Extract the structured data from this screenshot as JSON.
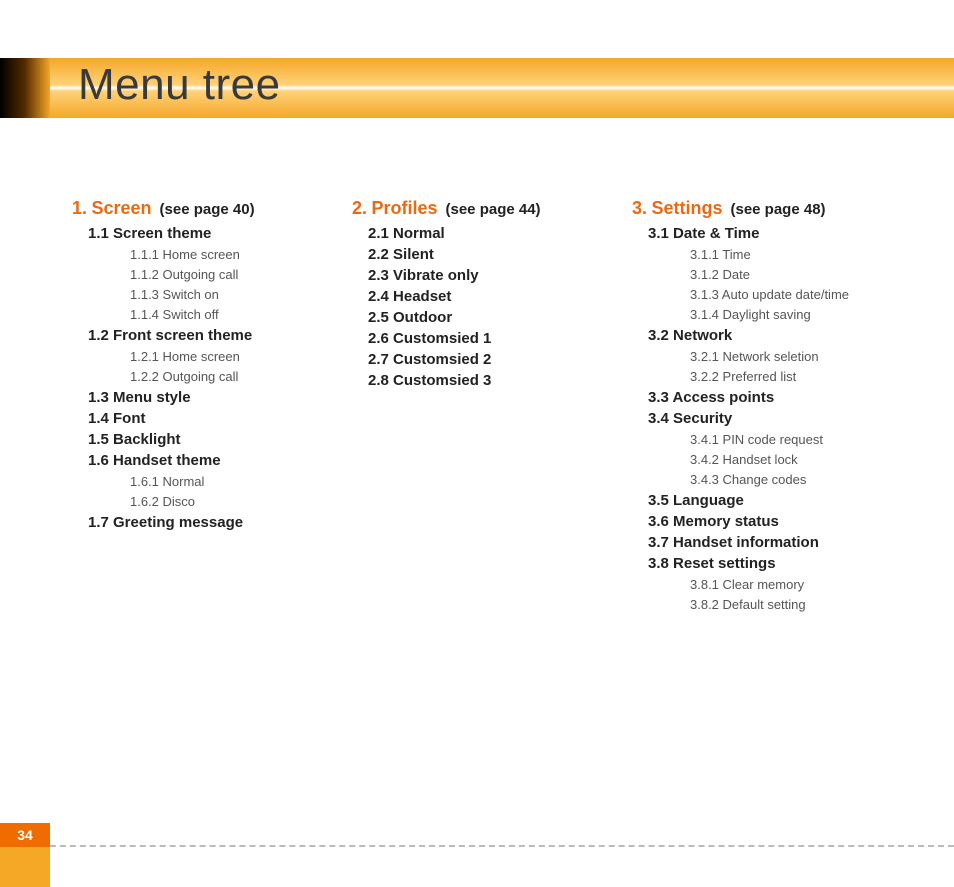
{
  "title": "Menu tree",
  "pageNumber": "34",
  "columns": [
    {
      "num": "1.",
      "name": "Screen",
      "ref": "(see page 40)",
      "items": [
        {
          "label": "1.1 Screen theme",
          "sub": [
            "1.1.1 Home screen",
            "1.1.2 Outgoing call",
            "1.1.3 Switch on",
            "1.1.4 Switch off"
          ]
        },
        {
          "label": "1.2 Front screen theme",
          "sub": [
            "1.2.1 Home screen",
            "1.2.2 Outgoing call"
          ]
        },
        {
          "label": "1.3 Menu style",
          "sub": []
        },
        {
          "label": "1.4 Font",
          "sub": []
        },
        {
          "label": "1.5 Backlight",
          "sub": []
        },
        {
          "label": "1.6 Handset theme",
          "sub": [
            "1.6.1 Normal",
            "1.6.2 Disco"
          ]
        },
        {
          "label": "1.7 Greeting message",
          "sub": []
        }
      ]
    },
    {
      "num": "2.",
      "name": "Profiles",
      "ref": "(see page 44)",
      "items": [
        {
          "label": "2.1 Normal",
          "sub": []
        },
        {
          "label": "2.2 Silent",
          "sub": []
        },
        {
          "label": "2.3 Vibrate only",
          "sub": []
        },
        {
          "label": "2.4 Headset",
          "sub": []
        },
        {
          "label": "2.5 Outdoor",
          "sub": []
        },
        {
          "label": "2.6 Customsied 1",
          "sub": []
        },
        {
          "label": "2.7 Customsied 2",
          "sub": []
        },
        {
          "label": "2.8 Customsied 3",
          "sub": []
        }
      ]
    },
    {
      "num": "3.",
      "name": "Settings",
      "ref": "(see page 48)",
      "items": [
        {
          "label": "3.1 Date & Time",
          "sub": [
            "3.1.1 Time",
            "3.1.2 Date",
            "3.1.3 Auto update date/time",
            "3.1.4 Daylight saving"
          ]
        },
        {
          "label": "3.2 Network",
          "sub": [
            "3.2.1 Network seletion",
            "3.2.2 Preferred list"
          ]
        },
        {
          "label": "3.3 Access points",
          "sub": []
        },
        {
          "label": "3.4 Security",
          "sub": [
            "3.4.1 PIN code request",
            "3.4.2 Handset lock",
            "3.4.3 Change codes"
          ]
        },
        {
          "label": "3.5 Language",
          "sub": []
        },
        {
          "label": "3.6 Memory status",
          "sub": []
        },
        {
          "label": "3.7 Handset information",
          "sub": []
        },
        {
          "label": "3.8 Reset settings",
          "sub": [
            "3.8.1 Clear memory",
            "3.8.2 Default setting"
          ]
        }
      ]
    }
  ]
}
